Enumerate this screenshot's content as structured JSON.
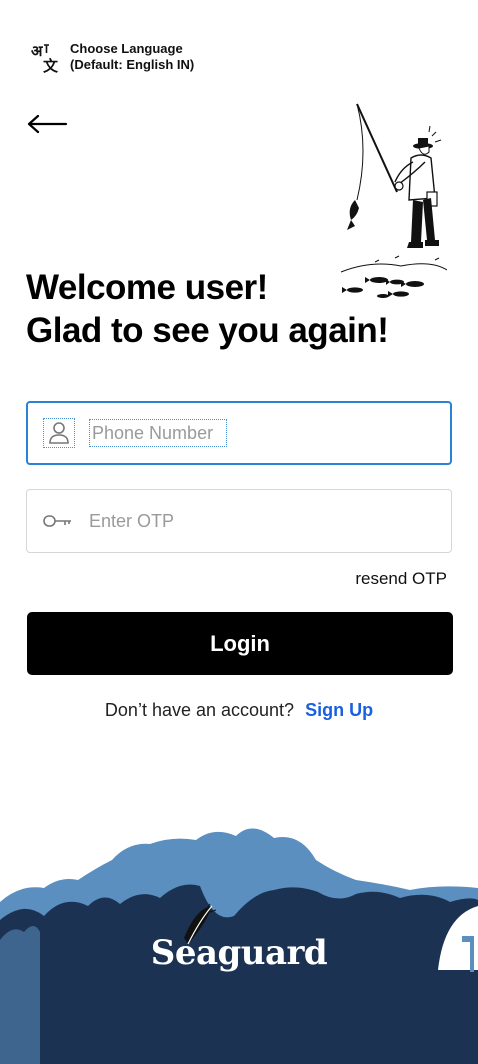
{
  "language": {
    "line1": "Choose Language",
    "line2": "(Default: English IN)",
    "icon": "translate-icon"
  },
  "nav": {
    "back_icon": "arrow-left-icon"
  },
  "heading": {
    "line1": "Welcome user!",
    "line2": "Glad to see you again!"
  },
  "form": {
    "phone_placeholder": "Phone Number",
    "phone_icon": "user-icon",
    "otp_placeholder": "Enter OTP",
    "otp_icon": "key-icon",
    "resend_label": "resend OTP",
    "login_label": "Login"
  },
  "signup": {
    "prompt": "Don’t have an account?",
    "link": "Sign Up"
  },
  "brand": {
    "name": "Seaguard"
  },
  "colors": {
    "accent_link": "#1a5fe0",
    "input_focus": "#2a82d6",
    "button_bg": "#000000",
    "wave_dark": "#1b3253",
    "wave_light": "#5b8fc0"
  }
}
